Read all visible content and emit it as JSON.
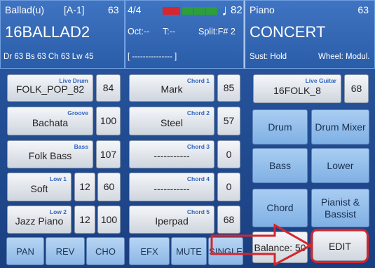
{
  "header": {
    "style_name": "Ballad(u)",
    "variation": "[A-1]",
    "tempo": "63",
    "style_title": "16BALLAD2",
    "channel_info": "Dr 63  Bs 63  Ch 63  Lw 45",
    "time_signature": "4/4",
    "bpm": "82",
    "octave": "Oct:--",
    "transpose": "T:--",
    "split": "Split:F# 2",
    "lyrics_bar": "[ --------------- ]",
    "beat_colors": [
      "#d7262e",
      "#2c9e3a",
      "#2c9e3a",
      "#2c9e3a"
    ],
    "voice_section": "Piano",
    "voice_number": "63",
    "voice_name": "CONCERT",
    "sustain": "Sust: Hold",
    "wheel": "Wheel: Modul."
  },
  "left_rows": [
    {
      "cap": "Live Drum",
      "label": "FOLK_POP_82",
      "value": "84"
    },
    {
      "cap": "Groove",
      "label": "Bachata",
      "value": "100"
    },
    {
      "cap": "Bass",
      "label": "Folk Bass",
      "value": "107"
    },
    {
      "cap": "Low 1",
      "label": "Soft",
      "octave": "12",
      "value": "60"
    },
    {
      "cap": "Low 2",
      "label": "Jazz Piano",
      "octave": "12",
      "value": "100"
    }
  ],
  "chord_rows": [
    {
      "cap": "Chord 1",
      "label": "Mark",
      "value": "85"
    },
    {
      "cap": "Chord 2",
      "label": "Steel",
      "value": "57"
    },
    {
      "cap": "Chord 3",
      "label": "-----------",
      "value": "0"
    },
    {
      "cap": "Chord 4",
      "label": "-----------",
      "value": "0"
    },
    {
      "cap": "Chord 5",
      "label": "Iperpad",
      "value": "68"
    }
  ],
  "right": {
    "live_guitar_cap": "Live Guitar",
    "live_guitar_label": "16FOLK_8",
    "live_guitar_value": "68",
    "drum": "Drum",
    "drum_mixer": "Drum Mixer",
    "bass": "Bass",
    "lower": "Lower",
    "chord": "Chord",
    "pianist_bassist": "Pianist & Bassist"
  },
  "bottom": {
    "pan": "PAN",
    "rev": "REV",
    "cho": "CHO",
    "efx": "EFX",
    "mute": "MUTE",
    "single": "SINGLE",
    "balance": "Balance: 50",
    "edit": "EDIT"
  },
  "colors": {
    "highlight_red": "#d4262e"
  }
}
